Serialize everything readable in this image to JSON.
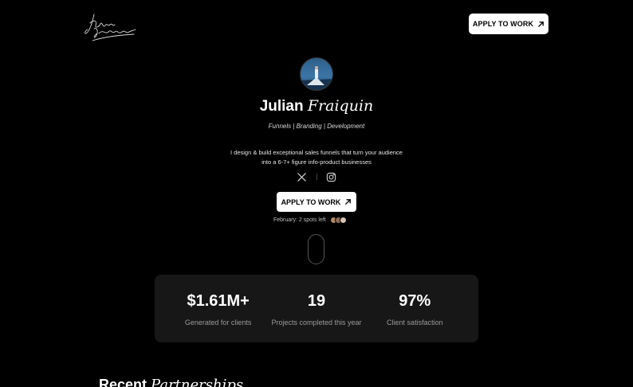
{
  "header": {
    "logo_text": "Julian Fraiquin",
    "cta_label": "APPLY TO WORK",
    "cta_icon": "arrow-up-right-icon"
  },
  "hero": {
    "name_first": "Julian",
    "name_last": "Fraiquin",
    "tagline": "Funnels | Branding | Development",
    "bio": "I design & build exceptional sales funnels that turn your audience into a 6-7+ figure info-product businesses",
    "socials": [
      "x-icon",
      "instagram-icon"
    ],
    "cta_label": "APPLY TO WORK",
    "spots_text": "February: 2 spots left"
  },
  "stats": [
    {
      "value": "$1.61M+",
      "label": "Generated for clients"
    },
    {
      "value": "19",
      "label": "Projects completed this year"
    },
    {
      "value": "97%",
      "label": "Client satisfaction"
    }
  ],
  "section": {
    "title_first": "Recent",
    "title_last": "Partnerships"
  },
  "colors": {
    "background": "#000000",
    "card": "#171717",
    "button": "#ffffff",
    "muted_text": "#9a9a9a"
  }
}
